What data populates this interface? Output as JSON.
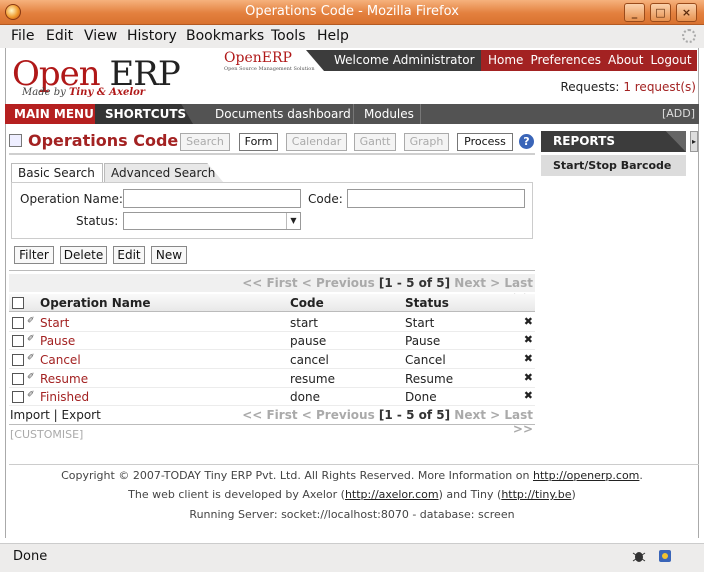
{
  "window": {
    "title": "Operations Code - Mozilla Firefox",
    "controls": [
      "_",
      "□",
      "×"
    ]
  },
  "menubar": [
    "File",
    "Edit",
    "View",
    "History",
    "Bookmarks",
    "Tools",
    "Help"
  ],
  "header": {
    "logo_main_1": "Open",
    "logo_main_2": "ERP",
    "logo_tagline_1": "Made by",
    "logo_tagline_2": "Tiny & Axelor",
    "small_logo": "OpenERP",
    "small_logo_sub": "Open Source Management Solution",
    "welcome": "Welcome Administrator",
    "nav": [
      "Home",
      "Preferences",
      "About",
      "Logout"
    ],
    "requests_label": "Requests:",
    "requests_value": "1 request(s)"
  },
  "navbar": {
    "main_menu": "MAIN MENU",
    "shortcuts": "SHORTCUTS",
    "links": [
      "Documents dashboard",
      "Modules"
    ],
    "add": "[ADD]"
  },
  "content": {
    "title": "Operations Code",
    "view_buttons": [
      {
        "label": "Search",
        "enabled": false
      },
      {
        "label": "Form",
        "enabled": true
      },
      {
        "label": "Calendar",
        "enabled": false
      },
      {
        "label": "Gantt",
        "enabled": false
      },
      {
        "label": "Graph",
        "enabled": false
      },
      {
        "label": "Process",
        "enabled": true
      }
    ],
    "help": "?"
  },
  "sidebar": {
    "reports_title": "REPORTS",
    "reports": [
      "Start/Stop Barcode"
    ]
  },
  "search": {
    "tabs": [
      "Basic Search",
      "Advanced Search"
    ],
    "fields": {
      "operation_name": "Operation Name:",
      "code": "Code:",
      "status": "Status:"
    },
    "values": {
      "operation_name": "",
      "code": "",
      "status": ""
    }
  },
  "actions": [
    "Filter",
    "Delete",
    "Edit",
    "New"
  ],
  "pager": {
    "first": "<< First",
    "previous": "< Previous",
    "range": "[1 - 5 of 5]",
    "next": "Next >",
    "last": "Last >>"
  },
  "grid": {
    "columns": [
      "Operation Name",
      "Code",
      "Status"
    ],
    "rows": [
      {
        "name": "Start",
        "code": "start",
        "status": "Start"
      },
      {
        "name": "Pause",
        "code": "pause",
        "status": "Pause"
      },
      {
        "name": "Cancel",
        "code": "cancel",
        "status": "Cancel"
      },
      {
        "name": "Resume",
        "code": "resume",
        "status": "Resume"
      },
      {
        "name": "Finished",
        "code": "done",
        "status": "Done"
      }
    ],
    "delete_glyph": "✖",
    "edit_glyph": "✐"
  },
  "grid_footer": {
    "import": "Import",
    "sep": "|",
    "export": "Export",
    "customise": "[CUSTOMISE]"
  },
  "footer": {
    "line1_text": "Copyright © 2007-TODAY Tiny ERP Pvt. Ltd. All Rights Reserved. More Information on",
    "line1_link": "http://openerp.com",
    "line1_end": ".",
    "line2_text": "The web client is developed by Axelor (",
    "line2_link1": "http://axelor.com",
    "line2_mid": ") and Tiny (",
    "line2_link2": "http://tiny.be",
    "line2_end": ")",
    "line3": "Running Server: socket://localhost:8070 - database: screen"
  },
  "statusbar": {
    "text": "Done"
  },
  "colors": {
    "accent_red": "#a32222",
    "dark": "#3c3c3c",
    "titlebar": "#e3803e"
  }
}
